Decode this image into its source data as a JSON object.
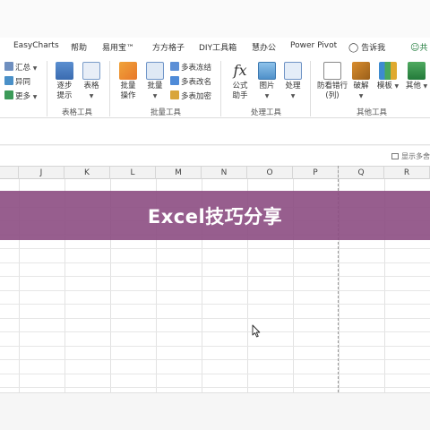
{
  "menu": {
    "items": [
      "EasyCharts",
      "帮助",
      "易用宝™",
      "方方格子",
      "DIY工具箱",
      "慧办公",
      "Power Pivot",
      "告诉我",
      "共"
    ]
  },
  "ribbon": {
    "summary": {
      "items": [
        "汇总",
        "异同",
        "更多"
      ]
    },
    "table_tools": {
      "tools": [
        "逐步提示",
        "表格"
      ],
      "label": "表格工具"
    },
    "batch_tools": {
      "tools": [
        "批量操作",
        "批量"
      ],
      "small": [
        "多表冻结",
        "多表改名",
        "多表加密"
      ],
      "label": "批量工具"
    },
    "process_tools": {
      "tools": [
        "公式助手",
        "图片",
        "处理"
      ],
      "label": "处理工具"
    },
    "other_tools": {
      "tools": [
        "防看错行(列)",
        "破解",
        "模板",
        "其他"
      ],
      "label": "其他工具"
    }
  },
  "show_more": "显示多舍",
  "columns": [
    "J",
    "K",
    "L",
    "M",
    "N",
    "O",
    "P",
    "Q",
    "R"
  ],
  "banner": {
    "title": "Excel技巧分享"
  },
  "colors": {
    "banner": "#8c4c82",
    "share": "#1e7a3a"
  }
}
